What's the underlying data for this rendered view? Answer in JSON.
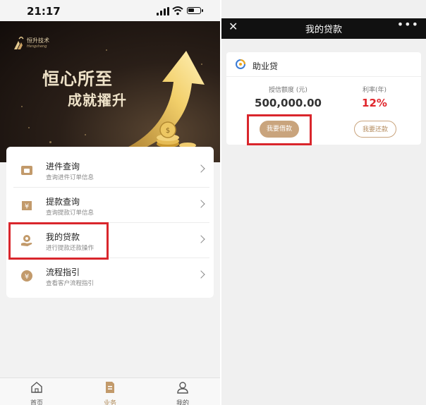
{
  "left": {
    "status": {
      "time": "21:17"
    },
    "banner": {
      "brand_cn": "恒升技术",
      "brand_en": "Hengsheng",
      "slogan_line1": "恒心所至",
      "slogan_line2": "成就擢升"
    },
    "menu": [
      {
        "title": "进件查询",
        "subtitle": "查询进件订单信息",
        "icon": "document-icon"
      },
      {
        "title": "提款查询",
        "subtitle": "查询提款订单信息",
        "icon": "yen-bag-icon"
      },
      {
        "title": "我的贷款",
        "subtitle": "进行提款还款操作",
        "icon": "hand-coin-icon"
      },
      {
        "title": "流程指引",
        "subtitle": "查看客户流程指引",
        "icon": "yen-circle-icon"
      }
    ],
    "tabs": [
      {
        "label": "首页",
        "icon": "home-icon"
      },
      {
        "label": "业务",
        "icon": "business-doc-icon",
        "active": true
      },
      {
        "label": "我的",
        "icon": "user-icon"
      }
    ],
    "highlight_color": "#d9262c"
  },
  "right": {
    "nav": {
      "close": "✕",
      "title": "我的贷款",
      "more": "•••"
    },
    "product": {
      "name": "助业贷",
      "credit_label": "授信额度 (元)",
      "credit_value": "500,000.00",
      "rate_label": "利率(年)",
      "rate_value": "12%",
      "borrow_button": "我要借款",
      "repay_button": "我要还款"
    },
    "accent_color": "#c9a47d",
    "rate_color": "#e0262c"
  }
}
